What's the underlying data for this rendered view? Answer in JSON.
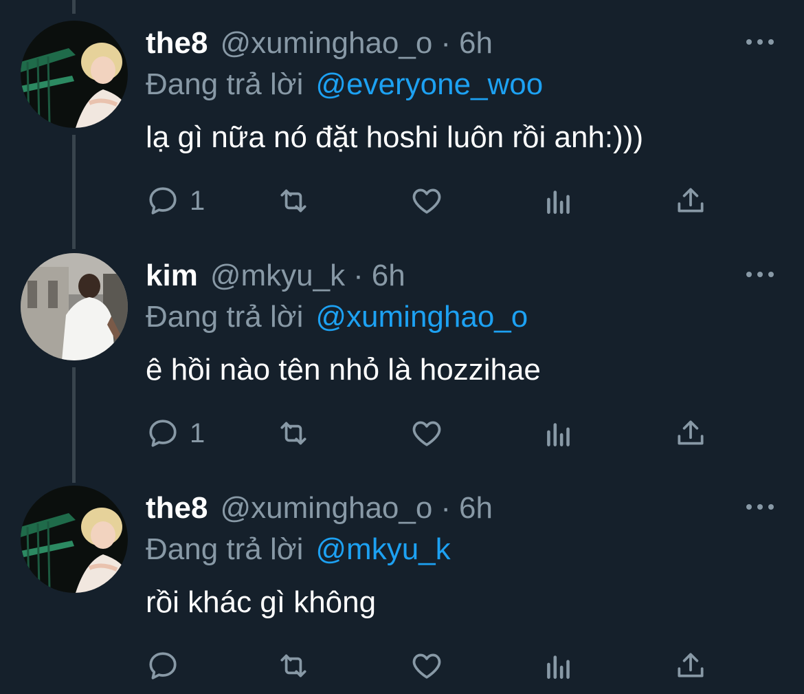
{
  "colors": {
    "background": "#15202b",
    "secondary_text": "#8899a6",
    "mention": "#1da1f2",
    "thread_line": "#38444d"
  },
  "tweets": [
    {
      "name": "the8",
      "handle": "@xuminghao_o",
      "separator": "·",
      "time": "6h",
      "reply_prefix": "Đang trả lời",
      "reply_to": "@everyone_woo",
      "text": "lạ gì nữa nó đặt hoshi luôn rồi anh:)))",
      "reply_count": "1",
      "avatar": "avatar-the8"
    },
    {
      "name": "kim",
      "handle": "@mkyu_k",
      "separator": "·",
      "time": "6h",
      "reply_prefix": "Đang trả lời",
      "reply_to": "@xuminghao_o",
      "text": "ê hồi nào tên nhỏ là hozzihae",
      "reply_count": "1",
      "avatar": "avatar-kim"
    },
    {
      "name": "the8",
      "handle": "@xuminghao_o",
      "separator": "·",
      "time": "6h",
      "reply_prefix": "Đang trả lời",
      "reply_to": "@mkyu_k",
      "text": "rồi khác gì không",
      "reply_count": "",
      "avatar": "avatar-the8"
    }
  ],
  "icons": {
    "reply": "reply-icon",
    "retweet": "retweet-icon",
    "like": "heart-icon",
    "analytics": "analytics-icon",
    "share": "share-icon",
    "more": "more-options-icon"
  }
}
